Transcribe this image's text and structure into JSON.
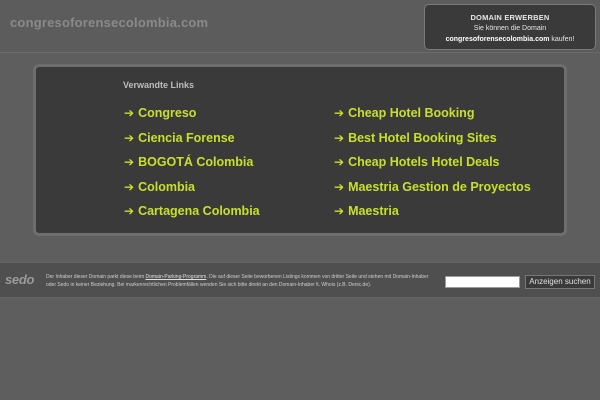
{
  "header": {
    "site_title": "congresoforensecolombia.com"
  },
  "buy_box": {
    "title": "DOMAIN ERWERBEN",
    "line1": "Sie können die Domain",
    "domain": "congresoforensecolombia.com",
    "line2_suffix": " kaufen!"
  },
  "links": {
    "heading": "Verwandte Links",
    "arrow": "➔",
    "left": [
      {
        "label": "Congreso"
      },
      {
        "label": "Ciencia Forense"
      },
      {
        "label": "BOGOTÁ Colombia"
      },
      {
        "label": "Colombia"
      },
      {
        "label": "Cartagena Colombia"
      }
    ],
    "right": [
      {
        "label": "Cheap Hotel Booking"
      },
      {
        "label": "Best Hotel Booking Sites"
      },
      {
        "label": "Cheap Hotels Hotel Deals"
      },
      {
        "label": "Maestria Gestion de Proyectos"
      },
      {
        "label": "Maestria"
      }
    ]
  },
  "footer": {
    "logo": "sedo",
    "text_before_link": "Der Inhaber dieser Domain parkt diese beim ",
    "link_text": "Domain-Parking-Programm",
    "text_after_link": ". Die auf dieser Seite beworbenen Listings kommen von dritter Seite und stehen mit Domain-Inhaber oder Sedo in keiner Beziehung. Bei markenrechtlichen Problemfällen wenden Sie sich bitte direkt an den Domain-Inhaber lt. Whois (z.B. Denic.de).",
    "search_value": "",
    "search_button": "Anzeigen suchen"
  },
  "colors": {
    "background": "#5e5e5e",
    "panel": "#3a3a3a",
    "link": "#c8e02a"
  }
}
